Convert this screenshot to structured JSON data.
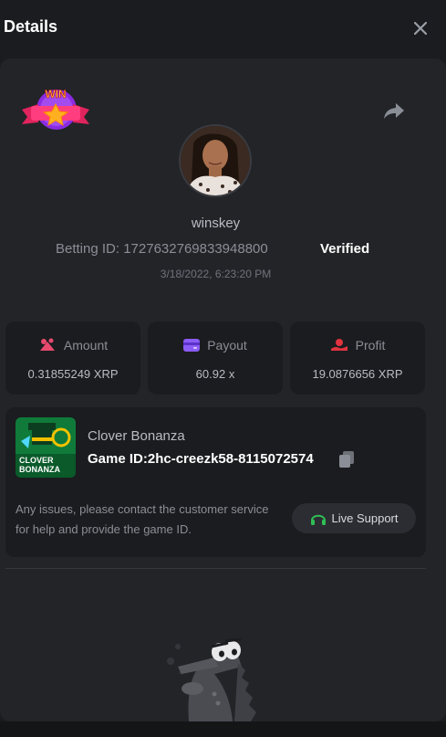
{
  "header": {
    "title": "Details",
    "close_icon": "close-icon"
  },
  "bet": {
    "badge_text": "WIN",
    "share_icon": "share-icon",
    "username": "winskey",
    "betting_id_label": "Betting ID:",
    "betting_id": "1727632769833948800",
    "verified_label": "Verified",
    "timestamp": "3/18/2022, 6:23:20 PM"
  },
  "stats": [
    {
      "label": "Amount",
      "value": "0.31855249 XRP",
      "icon": "coins-icon",
      "color": "#e84a6f"
    },
    {
      "label": "Payout",
      "value": "60.92 x",
      "icon": "wallet-icon",
      "color": "#8b5cf6"
    },
    {
      "label": "Profit",
      "value": "19.0876656 XRP",
      "icon": "hand-coin-icon",
      "color": "#e2333f"
    }
  ],
  "game": {
    "name": "Clover Bonanza",
    "id_label": "Game ID:",
    "id": "2hc-creezk58-8115072574",
    "thumb_text": "CLOVER BONANZA",
    "help_text": "Any issues, please contact the customer service for help and provide the game ID.",
    "support_label": "Live Support",
    "support_icon": "headset-icon",
    "support_color": "#2fbf56"
  },
  "colors": {
    "background": "#1b1c1f",
    "panel": "#232428",
    "card": "#1b1c1f"
  }
}
